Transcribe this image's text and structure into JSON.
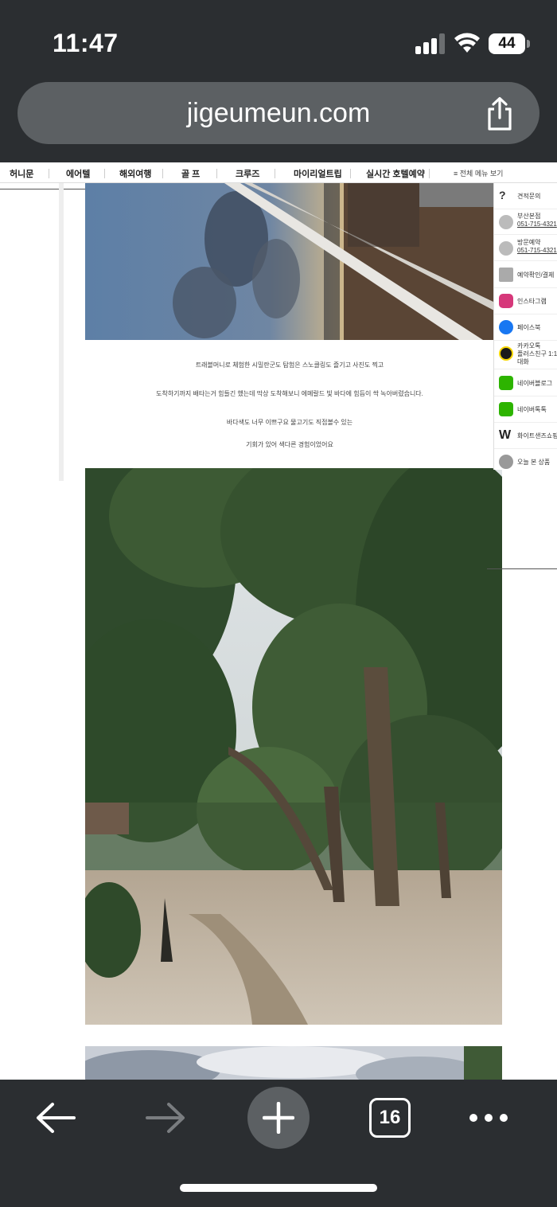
{
  "status": {
    "time": "11:47",
    "battery": "44"
  },
  "browser": {
    "url": "jigeumeun.com",
    "tab_count": "16"
  },
  "nav": {
    "items": [
      "허니문",
      "에어텔",
      "해외여행",
      "골 프",
      "크루즈",
      "마이리얼트립",
      "실시간 호텔예약"
    ],
    "all_menu": "전체 메뉴 보기"
  },
  "article": {
    "lines": [
      "트래블머니로 체험한 시밀란군도 탐험은 스노클링도 즐기고 사진도 찍고",
      "도착하기까지 배타는거 힘들긴 했는데 막상 도착해보니 에메랄드 빛 바다에 힘듬이 싹 녹아버렸습니다.",
      "바다색도 너무 이쁘구요 물고기도 직접볼수 있는",
      "기회가 있어 색다른 경험이었어요"
    ]
  },
  "quick_menu": {
    "estimate": "견적문의",
    "busan_label": "부산본점",
    "busan_phone": "051-715-4321",
    "visit_label": "방문예약",
    "visit_phone": "051-715-4321",
    "booking": "예약확인/결제",
    "instagram": "인스타그램",
    "facebook": "페이스북",
    "kakao_line1": "카카오톡",
    "kakao_line2": "플러스친구 1:1",
    "kakao_line3": "대화",
    "naver_blog": "네이버블로그",
    "naver_talk": "네이버톡톡",
    "white_shop": "화이트샌즈쇼핑",
    "recent": "오늘 본 상품"
  }
}
